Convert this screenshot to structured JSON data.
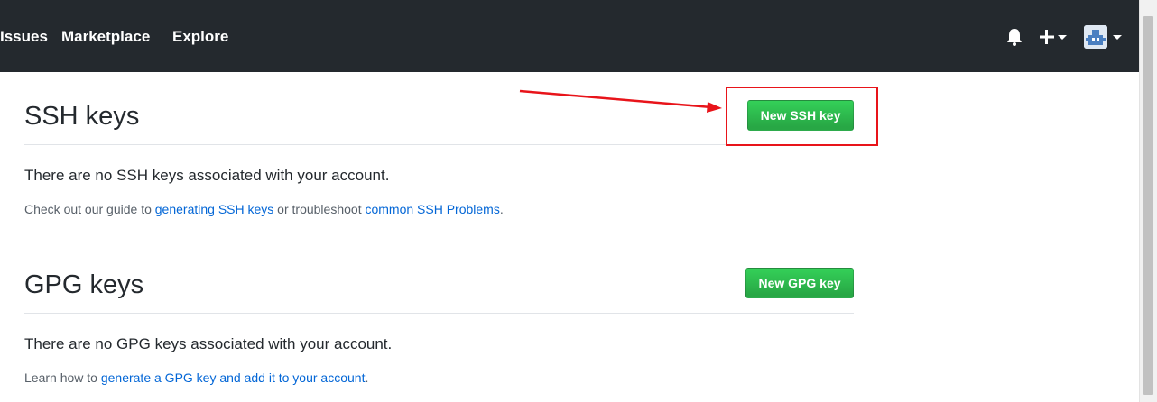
{
  "header": {
    "nav": [
      {
        "label": "Issues"
      },
      {
        "label": "Marketplace"
      },
      {
        "label": "Explore"
      }
    ],
    "icons": {
      "notifications": "bell-icon",
      "create": "plus-icon",
      "avatar": "avatar-icon"
    },
    "background": "#24292e"
  },
  "ssh": {
    "title": "SSH keys",
    "new_button": "New SSH key",
    "empty_message": "There are no SSH keys associated with your account.",
    "help_prefix": "Check out our guide to ",
    "help_link1": "generating SSH keys",
    "help_middle": " or troubleshoot ",
    "help_link2": "common SSH Problems",
    "help_suffix": "."
  },
  "gpg": {
    "title": "GPG keys",
    "new_button": "New GPG key",
    "empty_message": "There are no GPG keys associated with your account.",
    "help_prefix": "Learn how to ",
    "help_link": "generate a GPG key and add it to your account",
    "help_suffix": "."
  },
  "colors": {
    "accent_green": "#28a745",
    "link_blue": "#0366d6",
    "annotation_red": "#e8141a"
  }
}
